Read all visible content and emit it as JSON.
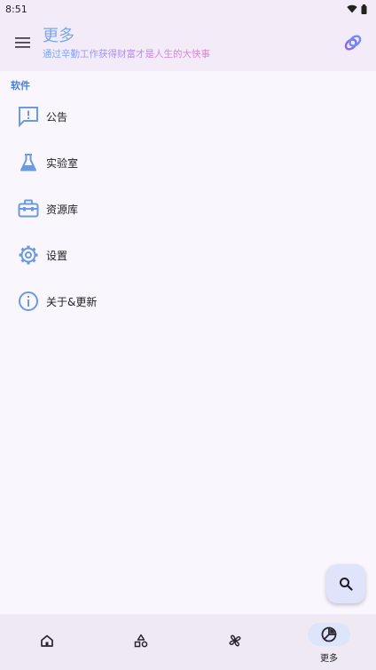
{
  "status_bar": {
    "time": "8:51"
  },
  "app_bar": {
    "title": "更多",
    "subtitle": "通过辛勤工作获得财富才是人生的大快事",
    "menu_icon": "menu-icon",
    "action_icon": "theme-rings-icon"
  },
  "section": {
    "title": "软件"
  },
  "menu_items": [
    {
      "label": "公告",
      "icon": "announcement-icon"
    },
    {
      "label": "实验室",
      "icon": "flask-icon"
    },
    {
      "label": "资源库",
      "icon": "toolbox-icon"
    },
    {
      "label": "设置",
      "icon": "gear-icon"
    },
    {
      "label": "关于&更新",
      "icon": "info-icon"
    }
  ],
  "fab": {
    "icon": "search-icon"
  },
  "bottom_nav": {
    "items": [
      {
        "icon": "home-icon",
        "label": ""
      },
      {
        "icon": "shapes-icon",
        "label": ""
      },
      {
        "icon": "pinwheel-icon",
        "label": ""
      },
      {
        "icon": "pie-chart-icon",
        "label": "更多",
        "active": true
      }
    ]
  },
  "colors": {
    "accent": "#7aa7ea",
    "icon_blue": "#6a9ae0",
    "app_bar_bg": "#f3ecf8",
    "page_bg": "#f9f6fd"
  }
}
